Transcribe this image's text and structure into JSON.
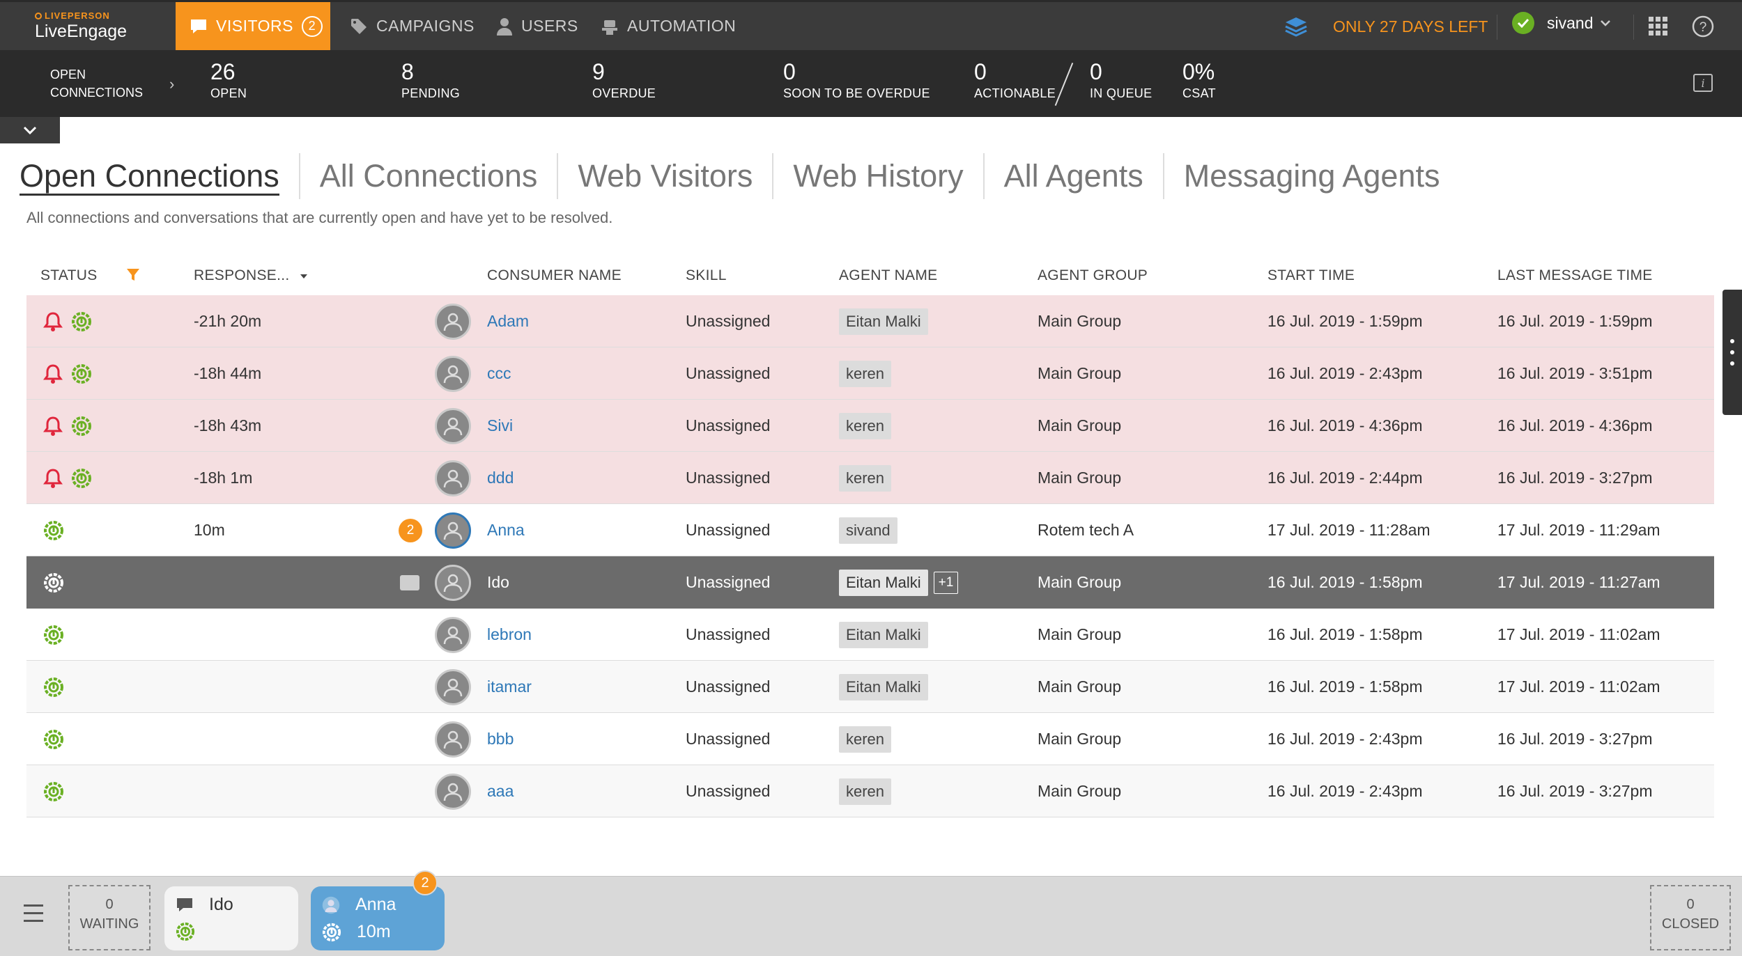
{
  "brand": {
    "top": "LIVEPERSON",
    "name": "LiveEngage"
  },
  "nav": {
    "visitors": "VISITORS",
    "visitors_badge": "2",
    "campaigns": "CAMPAIGNS",
    "users": "USERS",
    "automation": "AUTOMATION",
    "days_left": "ONLY 27 DAYS LEFT",
    "username": "sivand"
  },
  "stats": {
    "title": "OPEN CONNECTIONS",
    "items": [
      {
        "value": "26",
        "label": "OPEN"
      },
      {
        "value": "8",
        "label": "PENDING"
      },
      {
        "value": "9",
        "label": "OVERDUE"
      },
      {
        "value": "0",
        "label": "SOON TO BE OVERDUE"
      },
      {
        "value": "0",
        "label": "ACTIONABLE"
      },
      {
        "value": "0",
        "label": "IN QUEUE"
      },
      {
        "value": "0%",
        "label": "CSAT"
      }
    ]
  },
  "tabs": [
    "Open Connections",
    "All Connections",
    "Web Visitors",
    "Web History",
    "All Agents",
    "Messaging Agents"
  ],
  "subtitle": "All connections and conversations that are currently open and have yet to be resolved.",
  "columns": {
    "status": "STATUS",
    "response": "RESPONSE...",
    "consumer": "CONSUMER NAME",
    "skill": "SKILL",
    "agent": "AGENT NAME",
    "group": "AGENT GROUP",
    "start": "START TIME",
    "last": "LAST MESSAGE TIME"
  },
  "rows": [
    {
      "response": "-21h 20m",
      "consumer": "Adam",
      "skill": "Unassigned",
      "agent": "Eitan Malki",
      "group": "Main Group",
      "start": "16 Jul. 2019 - 1:59pm",
      "last": "16 Jul. 2019 - 1:59pm"
    },
    {
      "response": "-18h 44m",
      "consumer": "ccc",
      "skill": "Unassigned",
      "agent": "keren",
      "group": "Main Group",
      "start": "16 Jul. 2019 - 2:43pm",
      "last": "16 Jul. 2019 - 3:51pm"
    },
    {
      "response": "-18h 43m",
      "consumer": "Sivi",
      "skill": "Unassigned",
      "agent": "keren",
      "group": "Main Group",
      "start": "16 Jul. 2019 - 4:36pm",
      "last": "16 Jul. 2019 - 4:36pm"
    },
    {
      "response": "-18h 1m",
      "consumer": "ddd",
      "skill": "Unassigned",
      "agent": "keren",
      "group": "Main Group",
      "start": "16 Jul. 2019 - 2:44pm",
      "last": "16 Jul. 2019 - 3:27pm"
    },
    {
      "response": "10m",
      "badge": "2",
      "consumer": "Anna",
      "skill": "Unassigned",
      "agent": "sivand",
      "group": "Rotem tech A",
      "start": "17 Jul. 2019 - 11:28am",
      "last": "17 Jul. 2019 - 11:29am"
    },
    {
      "response": "",
      "consumer": "Ido",
      "skill": "Unassigned",
      "agent": "Eitan Malki",
      "agent_extra": "+1",
      "group": "Main Group",
      "start": "16 Jul. 2019 - 1:58pm",
      "last": "17 Jul. 2019 - 11:27am"
    },
    {
      "response": "",
      "consumer": "lebron",
      "skill": "Unassigned",
      "agent": "Eitan Malki",
      "group": "Main Group",
      "start": "16 Jul. 2019 - 1:58pm",
      "last": "17 Jul. 2019 - 11:02am"
    },
    {
      "response": "",
      "consumer": "itamar",
      "skill": "Unassigned",
      "agent": "Eitan Malki",
      "group": "Main Group",
      "start": "16 Jul. 2019 - 1:58pm",
      "last": "17 Jul. 2019 - 11:02am"
    },
    {
      "response": "",
      "consumer": "bbb",
      "skill": "Unassigned",
      "agent": "keren",
      "group": "Main Group",
      "start": "16 Jul. 2019 - 2:43pm",
      "last": "16 Jul. 2019 - 3:27pm"
    },
    {
      "response": "",
      "consumer": "aaa",
      "skill": "Unassigned",
      "agent": "keren",
      "group": "Main Group",
      "start": "16 Jul. 2019 - 2:43pm",
      "last": "16 Jul. 2019 - 3:27pm"
    }
  ],
  "tray": {
    "waiting_count": "0",
    "waiting_label": "WAITING",
    "closed_count": "0",
    "closed_label": "CLOSED",
    "ido_name": "Ido",
    "anna_name": "Anna",
    "anna_time": "10m",
    "anna_badge": "2"
  },
  "colors": {
    "accent": "#f7941d",
    "link": "#2e78b7",
    "alert_row": "#f5dfe1",
    "selected_row": "#6b6b6b",
    "status_green": "#6ab023",
    "alert_red": "#e0263c"
  }
}
